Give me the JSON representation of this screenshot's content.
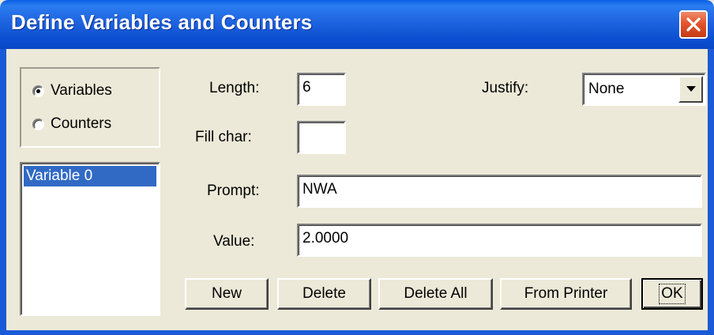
{
  "window": {
    "title": "Define Variables and Counters",
    "close_icon": "close-icon",
    "title_bar_color": "#0b4fd1",
    "close_button_color": "#e2562e"
  },
  "mode": {
    "options": [
      {
        "label": "Variables",
        "checked": true
      },
      {
        "label": "Counters",
        "checked": false
      }
    ]
  },
  "variables_list": {
    "items": [
      "Variable 0"
    ],
    "selected_index": 0,
    "selection_color": "#316ac5"
  },
  "form": {
    "length_label": "Length:",
    "length_value": "6",
    "justify_label": "Justify:",
    "justify_value": "None",
    "justify_icon": "chevron-down-icon",
    "fill_char_label": "Fill char:",
    "fill_char_value": "",
    "prompt_label": "Prompt:",
    "prompt_value": "NWA",
    "value_label": "Value:",
    "value_value": "2.0000"
  },
  "buttons": {
    "new": "New",
    "delete": "Delete",
    "delete_all": "Delete All",
    "from_printer": "From Printer",
    "ok": "OK"
  }
}
